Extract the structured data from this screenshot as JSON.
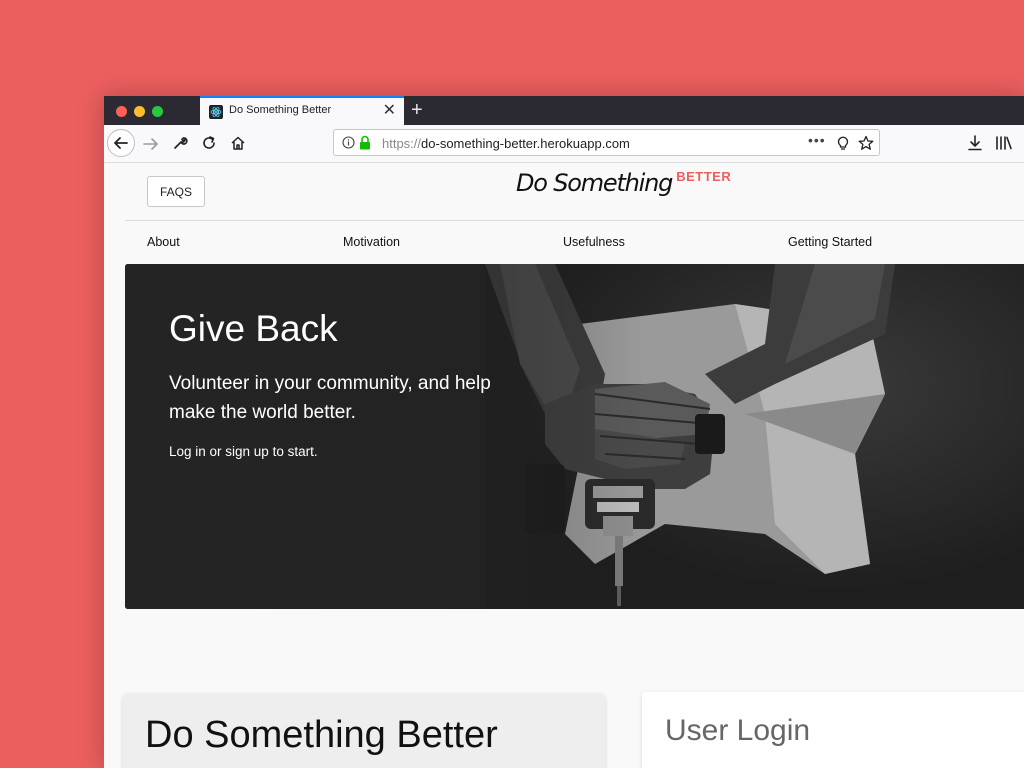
{
  "browser": {
    "tab_title": "Do Something Better",
    "tab_close": "✕",
    "new_tab": "+",
    "url_scheme": "https://",
    "url_host": "do-something-better.herokuapp.com",
    "url_menu": "•••",
    "tab_accent": "#0a84ff"
  },
  "header": {
    "faq_label": "FAQS",
    "logo_main": "Do Something",
    "logo_sub": "BETTER",
    "brand_color": "#ec5f5f"
  },
  "nav": {
    "items": [
      {
        "label": "About"
      },
      {
        "label": "Motivation"
      },
      {
        "label": "Usefulness"
      },
      {
        "label": "Getting Started"
      }
    ]
  },
  "hero": {
    "title": "Give Back",
    "subtitle": "Volunteer in your community, and help make the world better.",
    "note": "Log in or sign up to start."
  },
  "cards": {
    "left_title": "Do Something Better",
    "right_title": "User Login"
  }
}
